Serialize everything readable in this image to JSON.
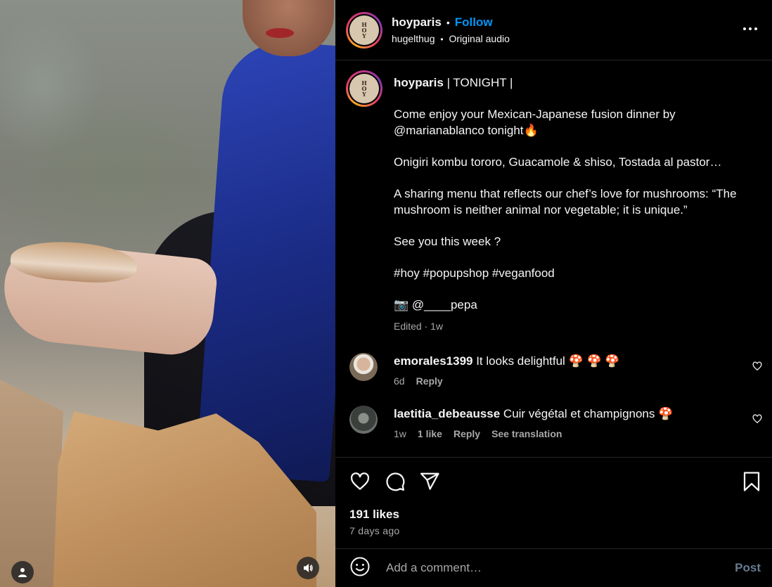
{
  "post": {
    "author": "hoyparis",
    "follow_label": "Follow",
    "separator": "•",
    "avatar_text": "HOY",
    "audio_credit": "hugelthug",
    "audio_label": "Original audio",
    "more_icon": "more-horizontal-icon"
  },
  "caption": {
    "author": "hoyparis",
    "headline": " | TONIGHT |",
    "paragraphs": [
      "Come enjoy your Mexican-Japanese fusion dinner by @marianablanco tonight🔥",
      "Onigiri kombu tororo, Guacamole & shiso, Tostada al pastor…",
      "A sharing menu that reflects our chef’s love for mushrooms: “The mushroom is neither animal nor vegetable; it is unique.”",
      "See you this week ?",
      "#hoy #popupshop #veganfood",
      "📷 @____pepa"
    ],
    "meta": "Edited · 1w"
  },
  "comments": [
    {
      "username": "emorales1399",
      "text": " It looks delightful  🍄 🍄 🍄",
      "time": "6d",
      "likes": "",
      "reply": "Reply",
      "translate": ""
    },
    {
      "username": "laetitia_debeausse",
      "text": " Cuir végétal et champignons  🍄",
      "time": "1w",
      "likes": "1 like",
      "reply": "Reply",
      "translate": "See translation"
    }
  ],
  "actions": {
    "likes": "191 likes",
    "age": "7 days ago"
  },
  "composer": {
    "placeholder": "Add a comment…",
    "post_label": "Post"
  },
  "colors": {
    "accent": "#0095f6",
    "background": "#000000",
    "muted": "#a8a8a8",
    "divider": "#262626",
    "post_disabled": "#677b91"
  }
}
